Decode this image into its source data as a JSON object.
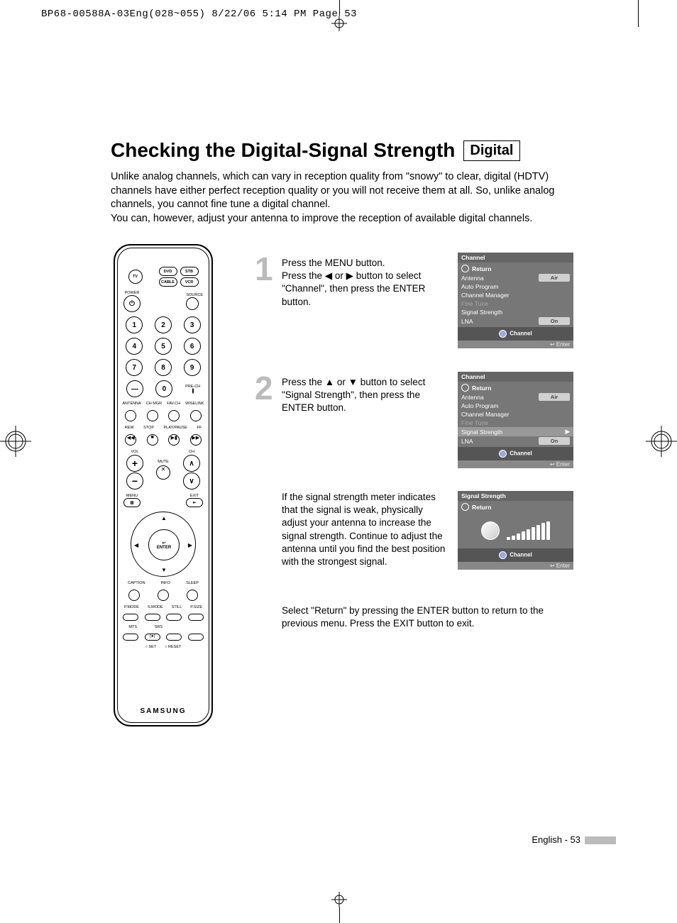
{
  "header": "BP68-00588A-03Eng(028~055)  8/22/06  5:14 PM  Page 53",
  "title": "Checking the Digital-Signal Strength",
  "title_tag": "Digital",
  "intro": "Unlike analog channels, which can vary in reception quality from \"snowy\" to clear, digital (HDTV) channels have either perfect reception quality or you will not receive them at all. So, unlike analog channels, you cannot fine tune a digital channel.\nYou can, however, adjust your antenna to improve the reception of available digital channels.",
  "steps": {
    "s1": {
      "num": "1",
      "text": "Press the MENU button.\nPress the ◀ or ▶ button to select \"Channel\", then press the ENTER button."
    },
    "s2": {
      "num": "2",
      "text": "Press the ▲ or ▼ button to select \"Signal Strength\", then press the ENTER button."
    }
  },
  "note3": "If the signal strength meter indicates that the signal is weak, physically adjust your antenna to increase the signal strength. Continue to adjust the antenna until you find the best position with the strongest signal.",
  "note4": "Select \"Return\" by pressing the ENTER button to return to the previous menu. Press the EXIT button to exit.",
  "osd": {
    "channel_title": "Channel",
    "return": "Return",
    "antenna": "Antenna",
    "antenna_val": "Air",
    "auto_program": "Auto Program",
    "channel_manager": "Channel Manager",
    "fine_tune": "Fine Tune",
    "signal_strength": "Signal Strength",
    "lna": "LNA",
    "lna_val": "On",
    "channel_footer": "Channel",
    "enter": "Enter",
    "sig_title": "Signal Strength",
    "arrow": "▶"
  },
  "remote": {
    "top": {
      "tv": "TV",
      "dvd": "DVD",
      "stb": "STB",
      "cable": "CABLE",
      "vcr": "VCR"
    },
    "power": "POWER",
    "source": "SOURCE",
    "prech": "PRE-CH",
    "row_labels": {
      "antenna": "ANTENNA",
      "chmgr": "CH MGR",
      "favch": "FAV.CH",
      "wiselink": "WISELINK",
      "rew": "REW",
      "stop": "STOP",
      "play": "PLAY/PAUSE",
      "ff": "FF",
      "vol": "VOL",
      "ch": "CH",
      "mute": "MUTE",
      "menu": "MENU",
      "exit": "EXIT",
      "enter": "ENTER",
      "caption": "CAPTION",
      "info": "INFO",
      "sleep": "SLEEP",
      "pmode": "P.MODE",
      "smode": "S.MODE",
      "still": "STILL",
      "psize": "P.SIZE",
      "mts": "MTS",
      "srs": "SRS",
      "set": "SET",
      "reset": "RESET"
    },
    "brand": "SAMSUNG"
  },
  "footer": "English - 53"
}
